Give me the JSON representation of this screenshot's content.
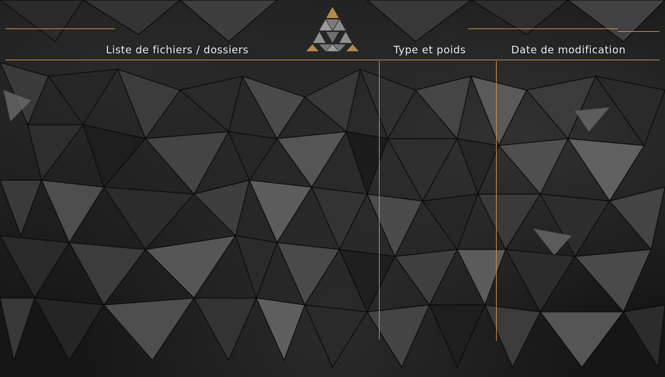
{
  "header": {
    "columns": [
      {
        "label": "Liste de fichiers / dossiers"
      },
      {
        "label": "Type et poids"
      },
      {
        "label": "Date de modification"
      }
    ]
  },
  "colors": {
    "accent": "#c8934a",
    "background": "#161616",
    "text": "#f2f2f2",
    "logo_gold": "#b5894a",
    "logo_gray": "#8a8a8a"
  },
  "logo": {
    "icon": "triforce-logo-icon"
  }
}
